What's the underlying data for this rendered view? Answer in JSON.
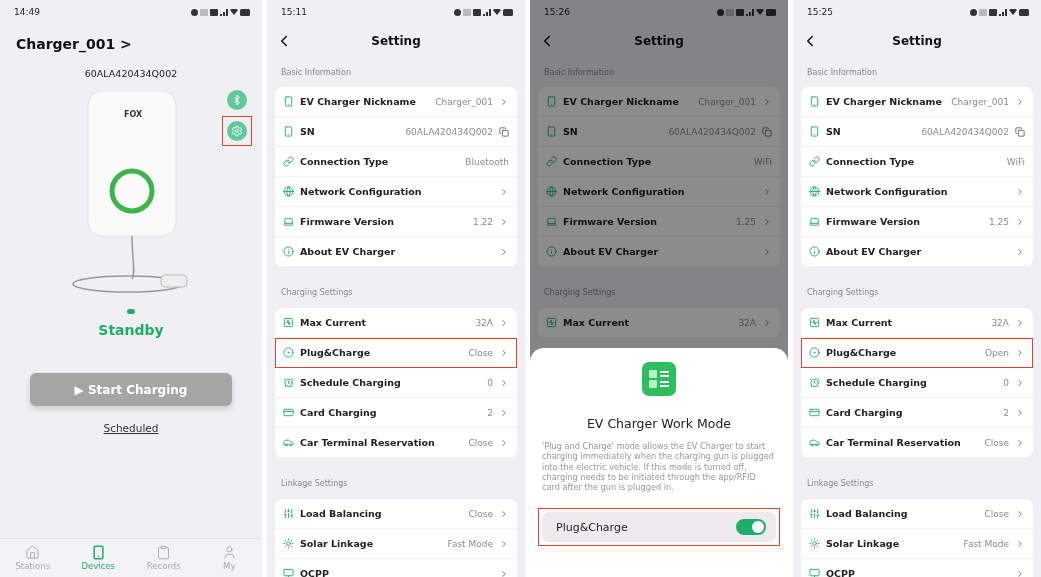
{
  "screens": [
    {
      "kind": "home",
      "time": "14:49",
      "title": "Charger_001 >",
      "serial": "60ALA420434Q002",
      "logo_text": "FOX",
      "settings_button": {
        "highlighted": true
      },
      "status": "Standby",
      "start_button": "▶ Start Charging",
      "scheduled_link": "Scheduled",
      "tabs": [
        {
          "label": "Stations",
          "selected": false
        },
        {
          "label": "Devices",
          "selected": true
        },
        {
          "label": "Records",
          "selected": false
        },
        {
          "label": "My",
          "selected": false
        }
      ]
    },
    {
      "kind": "settings",
      "time": "15:11",
      "title": "Setting",
      "dimmed": false,
      "sections": [
        {
          "title": "Basic Information",
          "rows": [
            {
              "label": "EV Charger Nickname",
              "value": "Charger_001",
              "kind": "link",
              "highlighted": false
            },
            {
              "label": "SN",
              "value": "60ALA420434Q002",
              "kind": "copy",
              "highlighted": false
            },
            {
              "label": "Connection Type",
              "value": "Bluetooth",
              "kind": "info",
              "highlighted": false
            },
            {
              "label": "Network Configuration",
              "kind": "link",
              "highlighted": false
            },
            {
              "label": "Firmware Version",
              "value": "1.22",
              "kind": "link",
              "highlighted": false
            },
            {
              "label": "About EV Charger",
              "kind": "link",
              "highlighted": false
            }
          ]
        },
        {
          "title": "Charging Settings",
          "rows": [
            {
              "label": "Max Current",
              "value": "32A",
              "kind": "link",
              "highlighted": false
            },
            {
              "label": "Plug&Charge",
              "value": "Close",
              "kind": "link",
              "highlighted": true
            },
            {
              "label": "Schedule Charging",
              "value": "0",
              "kind": "link",
              "highlighted": false
            },
            {
              "label": "Card Charging",
              "value": "2",
              "kind": "link",
              "highlighted": false
            },
            {
              "label": "Car Terminal Reservation",
              "value": "Close",
              "kind": "link",
              "highlighted": false
            }
          ]
        },
        {
          "title": "Linkage Settings",
          "rows": [
            {
              "label": "Load Balancing",
              "value": "Close",
              "kind": "link",
              "highlighted": false
            },
            {
              "label": "Solar Linkage",
              "value": "Fast Mode",
              "kind": "link",
              "highlighted": false
            },
            {
              "label": "OCPP",
              "kind": "link",
              "highlighted": false
            }
          ]
        }
      ]
    },
    {
      "kind": "settings",
      "time": "15:26",
      "title": "Setting",
      "dimmed": true,
      "sections": [
        {
          "title": "Basic Information",
          "rows": [
            {
              "label": "EV Charger Nickname",
              "value": "Charger_001",
              "kind": "link",
              "highlighted": false
            },
            {
              "label": "SN",
              "value": "60ALA420434Q002",
              "kind": "copy",
              "highlighted": false
            },
            {
              "label": "Connection Type",
              "value": "WiFi",
              "kind": "info",
              "highlighted": false
            },
            {
              "label": "Network Configuration",
              "kind": "link",
              "highlighted": false
            },
            {
              "label": "Firmware Version",
              "value": "1.25",
              "kind": "link",
              "highlighted": false
            },
            {
              "label": "About EV Charger",
              "kind": "link",
              "highlighted": false
            }
          ]
        },
        {
          "title": "Charging Settings",
          "rows": [
            {
              "label": "Max Current",
              "value": "32A",
              "kind": "link",
              "highlighted": false
            }
          ]
        }
      ],
      "sheet": {
        "title": "EV Charger Work Mode",
        "description": "'Plug and Charge' mode allows the EV Charger to start charging immediately when the charging gun is plugged into the electric vehicle. If this mode is turned off, charging needs to be initiated through the app/RFID card after the gun is plugged in.",
        "toggle": {
          "label": "Plug&Charge",
          "on": true,
          "highlighted": true
        }
      }
    },
    {
      "kind": "settings",
      "time": "15:25",
      "title": "Setting",
      "dimmed": false,
      "sections": [
        {
          "title": "Basic Information",
          "rows": [
            {
              "label": "EV Charger Nickname",
              "value": "Charger_001",
              "kind": "link",
              "highlighted": false
            },
            {
              "label": "SN",
              "value": "60ALA420434Q002",
              "kind": "copy",
              "highlighted": false
            },
            {
              "label": "Connection Type",
              "value": "WiFi",
              "kind": "info",
              "highlighted": false
            },
            {
              "label": "Network Configuration",
              "kind": "link",
              "highlighted": false
            },
            {
              "label": "Firmware Version",
              "value": "1.25",
              "kind": "link",
              "highlighted": false
            },
            {
              "label": "About EV Charger",
              "kind": "link",
              "highlighted": false
            }
          ]
        },
        {
          "title": "Charging Settings",
          "rows": [
            {
              "label": "Max Current",
              "value": "32A",
              "kind": "link",
              "highlighted": false
            },
            {
              "label": "Plug&Charge",
              "value": "Open",
              "kind": "link",
              "highlighted": true
            },
            {
              "label": "Schedule Charging",
              "value": "0",
              "kind": "link",
              "highlighted": false
            },
            {
              "label": "Card Charging",
              "value": "2",
              "kind": "link",
              "highlighted": false
            },
            {
              "label": "Car Terminal Reservation",
              "value": "Close",
              "kind": "link",
              "highlighted": false
            }
          ]
        },
        {
          "title": "Linkage Settings",
          "rows": [
            {
              "label": "Load Balancing",
              "value": "Close",
              "kind": "link",
              "highlighted": false
            },
            {
              "label": "Solar Linkage",
              "value": "Fast Mode",
              "kind": "link",
              "highlighted": false
            },
            {
              "label": "OCPP",
              "kind": "link",
              "highlighted": false
            }
          ]
        }
      ]
    }
  ]
}
